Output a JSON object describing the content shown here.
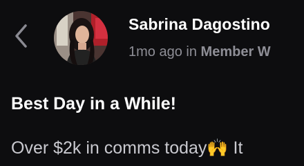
{
  "nav": {
    "back_icon": "chevron-left-icon"
  },
  "post": {
    "author_name": "Sabrina Dagostino",
    "time_ago": "1mo ago",
    "in_word": "in",
    "space_name": "Member W",
    "title": "Best Day in a While!",
    "body_preview": "Over $2k in comms today🙌 It"
  },
  "colors": {
    "background": "#0d0d0f",
    "primary_text": "#ffffff",
    "secondary_text": "#8e8e96"
  }
}
